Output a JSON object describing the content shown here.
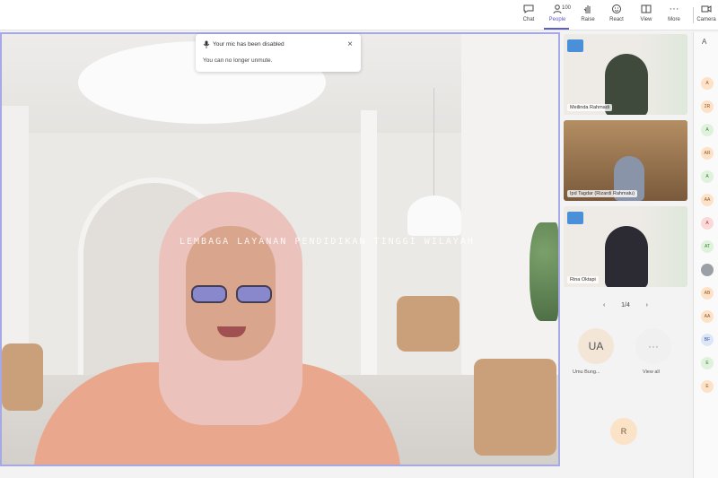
{
  "toolbar": {
    "buttons": [
      {
        "label": "Chat",
        "icon": "chat-icon"
      },
      {
        "label": "People",
        "icon": "people-icon",
        "count": "100"
      },
      {
        "label": "Raise",
        "icon": "raise-hand-icon"
      },
      {
        "label": "React",
        "icon": "react-icon"
      },
      {
        "label": "View",
        "icon": "view-icon"
      },
      {
        "label": "More",
        "icon": "more-icon"
      },
      {
        "label": "Camera",
        "icon": "camera-icon"
      }
    ],
    "active": "People"
  },
  "toast": {
    "title": "Your mic has been disabled",
    "body": "You can no longer unmute.",
    "close": "×"
  },
  "watermark": "LEMBAGA LAYANAN PENDIDIKAN TINGGI WILAYAH",
  "tiles": [
    {
      "name": "Meilinda Rahmadi"
    },
    {
      "name": "Ipd Tagdar (Rizardi Rahmatu)"
    },
    {
      "name": "Rina Oktapi"
    }
  ],
  "pager": {
    "prev": "‹",
    "label": "1/4",
    "next": "›"
  },
  "avatars": {
    "ua_initials": "UA",
    "ua_name": "Umu Bung...",
    "more_label": "View all",
    "more_symbol": "···",
    "r_initial": "R"
  },
  "roster": {
    "head": "A",
    "items": [
      "A",
      "2R",
      "A",
      "AR",
      "A",
      "AA",
      "A",
      "AT",
      "",
      "AB",
      "AA",
      "BF",
      "E",
      "E"
    ]
  },
  "colors": {
    "accent": "#5b5fc7",
    "stage_border": "#a7a9e6"
  }
}
